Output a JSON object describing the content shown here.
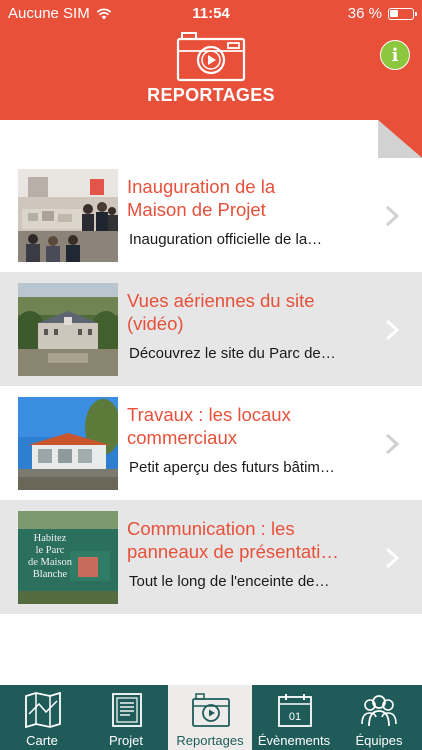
{
  "status_bar": {
    "carrier": "Aucune SIM",
    "time": "11:54",
    "battery": "36 %",
    "battery_level": 0.36
  },
  "header": {
    "title": "REPORTAGES",
    "info_label": "i",
    "icon": "camera-play-icon",
    "accent_color": "#e8503a"
  },
  "reportages": [
    {
      "title_line1": "Inauguration de la",
      "title_line2": "Maison de Projet",
      "description": "Inauguration officielle de la…"
    },
    {
      "title_line1": "Vues aériennes du site",
      "title_line2": "(vidéo)",
      "description": "Découvrez le site du Parc de…"
    },
    {
      "title_line1": "Travaux : les locaux",
      "title_line2": "commerciaux",
      "description": "Petit aperçu des futurs bâtim…"
    },
    {
      "title_line1": "Communication : les",
      "title_line2": "panneaux de présentati…",
      "description": "Tout le long de l'enceinte de…",
      "thumb_text": [
        "Habitez",
        "le Parc",
        "de Maison",
        "Blanche"
      ]
    }
  ],
  "tabbar": {
    "background": "#1f5c59",
    "tabs": [
      {
        "label": "Carte",
        "icon": "map-icon"
      },
      {
        "label": "Projet",
        "icon": "document-icon"
      },
      {
        "label": "Reportages",
        "icon": "camera-play-icon",
        "active": true
      },
      {
        "label": "Évènements",
        "icon": "calendar-icon",
        "day": "01"
      },
      {
        "label": "Équipes",
        "icon": "people-icon"
      }
    ]
  }
}
